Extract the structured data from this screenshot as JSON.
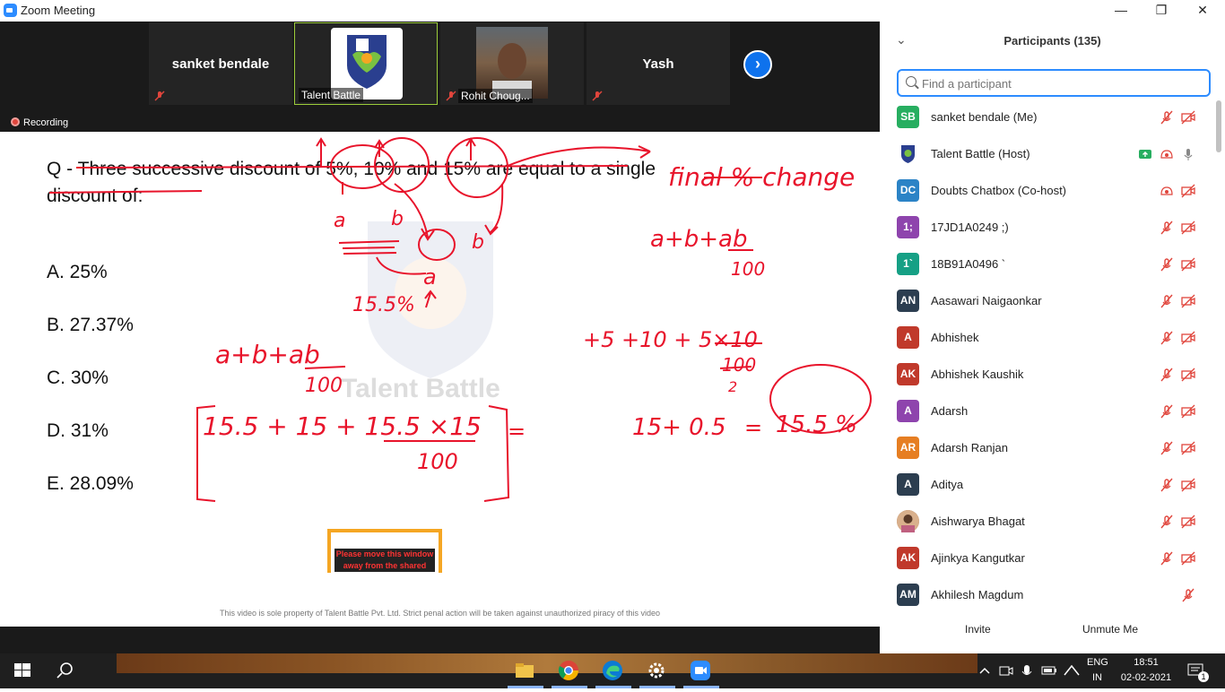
{
  "window": {
    "title": "Zoom Meeting",
    "minimize": "—",
    "maximize": "❐",
    "close": "✕"
  },
  "videos": [
    {
      "name": "sanket bendale",
      "label": ""
    },
    {
      "name": "",
      "label": "Talent Battle"
    },
    {
      "name": "",
      "label": "Rohit Choug..."
    },
    {
      "name": "Yash",
      "label": ""
    }
  ],
  "next_arrow": "›",
  "recording_label": "Recording",
  "share": {
    "question": "Q - Three successive discount of 5%, 10% and 15% are equal to a single discount of:",
    "options": [
      "A. 25%",
      "B. 27.37%",
      "C. 30%",
      "D. 31%",
      "E. 28.09%"
    ],
    "warning": "Please move this window away from the shared",
    "footer_note": "This video is sole property of Talent Battle Pvt. Ltd. Strict penal action will be taken against unauthorized piracy of this video",
    "watermark_text": "Talent Battle",
    "annotations": {
      "final": "final % change",
      "formula_right": "a+b+ab",
      "over100a": "100",
      "calc": "+5 +10 + 5×10",
      "over100b": "100",
      "two": "2",
      "res_left": "15+ 0.5",
      "equals": "=",
      "result": "15.5 %",
      "a1": "a",
      "b1": "b",
      "b2": "b",
      "a2": "a",
      "pct": "15.5%",
      "formula_left": "a+b+ab",
      "over100c": "100",
      "bracket_expr": "15.5 + 15  +  15.5 ×15",
      "over100d": "100",
      "trail_eq": "="
    }
  },
  "participants_panel": {
    "title": "Participants (135)",
    "search_placeholder": "Find a participant",
    "invite": "Invite",
    "unmute_me": "Unmute Me",
    "list": [
      {
        "initials": "SB",
        "name": "sanket bendale (Me)",
        "color": "#27ae60"
      },
      {
        "initials": "",
        "name": "Talent Battle (Host)",
        "color": "#ffffff"
      },
      {
        "initials": "DC",
        "name": "Doubts Chatbox (Co-host)",
        "color": "#2b83c6"
      },
      {
        "initials": "1;",
        "name": "17JD1A0249 ;)",
        "color": "#8e44ad"
      },
      {
        "initials": "1`",
        "name": "18B91A0496 `",
        "color": "#16a085"
      },
      {
        "initials": "AN",
        "name": "Aasawari Naigaonkar",
        "color": "#2c3e50"
      },
      {
        "initials": "A",
        "name": "Abhishek",
        "color": "#c0392b"
      },
      {
        "initials": "AK",
        "name": "Abhishek Kaushik",
        "color": "#c0392b"
      },
      {
        "initials": "A",
        "name": "Adarsh",
        "color": "#8e44ad"
      },
      {
        "initials": "AR",
        "name": "Adarsh Ranjan",
        "color": "#e67e22"
      },
      {
        "initials": "A",
        "name": "Aditya",
        "color": "#2c3e50"
      },
      {
        "initials": "",
        "name": "Aishwarya Bhagat",
        "color": "#b07b5a"
      },
      {
        "initials": "AK",
        "name": "Ajinkya Kangutkar",
        "color": "#c0392b"
      },
      {
        "initials": "AM",
        "name": "Akhilesh Magdum",
        "color": "#2c3e50"
      }
    ]
  },
  "taskbar": {
    "lang_top": "ENG",
    "lang_bottom": "IN",
    "time": "18:51",
    "date": "02-02-2021",
    "notif_count": "1"
  }
}
